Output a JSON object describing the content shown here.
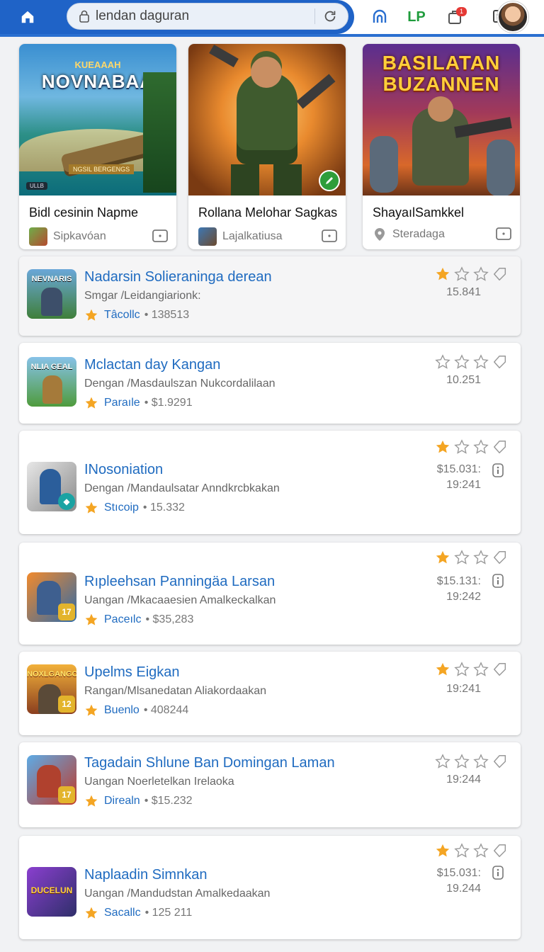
{
  "browser": {
    "url_text": "lendan daguran",
    "cart_badge": "1",
    "lp_label": "LP"
  },
  "featured": [
    {
      "title": "Bidl cesinin Napme",
      "meta": "Sipkavóan",
      "art_title": "NOVNABAA",
      "art_sub": "KUEAAAH",
      "art_tag": "NGSIL BERGENGS",
      "art_tag2": "ULLB"
    },
    {
      "title": "Rollana Melohar Sagkas",
      "meta": "Lajalkatiusa"
    },
    {
      "title": "ShayaılSamkkel",
      "meta": "Steradaga",
      "art_title_1": "BASILATAN",
      "art_title_2": "BUZANNEN"
    }
  ],
  "items": [
    {
      "name": "Nadarsin Solieraninga derean",
      "sub": "Smgar /Leidangiarionk:",
      "publisher": "Tâcollc",
      "count": "• 138513",
      "stars": 1,
      "numbers": [
        "15.841"
      ],
      "has_info": false,
      "icon_label": "NEVNARIS",
      "overlay": ""
    },
    {
      "name": "Mclactan day Kangan",
      "sub": "Dengan /Masdaulszan Nukcordalilaan",
      "publisher": "Paraıle",
      "count": "• $1.9291",
      "stars": 0,
      "numbers": [
        "10.251"
      ],
      "has_info": false,
      "icon_label": "NLIA GEAL",
      "overlay": ""
    },
    {
      "name": "INosoniation",
      "sub": "Dengan /Mandaulsatar Anndkrcbkakan",
      "publisher": "Stıcoip",
      "count": "• 15.332",
      "stars": 1,
      "numbers": [
        "$15.031:",
        "19:241"
      ],
      "has_info": true,
      "icon_label": "",
      "overlay": ""
    },
    {
      "name": "Rıpleehsan Panningäa Larsan",
      "sub": "Uangan /Mkacaaesien Amalkeckalkan",
      "publisher": "Paceılc",
      "count": "• $35,283",
      "stars": 1,
      "numbers": [
        "$15.131:",
        "19:242"
      ],
      "has_info": true,
      "icon_label": "",
      "overlay": "17"
    },
    {
      "name": "Upelms Eigkan",
      "sub": "Rangan/Mlsanedatan Aliakordaakan",
      "publisher": "Buenlo",
      "count": "• 408244",
      "stars": 1,
      "numbers": [
        "19:241"
      ],
      "has_info": false,
      "icon_label": "NOXLGANGO",
      "overlay": "12"
    },
    {
      "name": "Tagadain Shlune Ban Domingan Laman",
      "sub": "Uangan Noerletelkan Irelaoka",
      "publisher": "Direaln",
      "count": "• $15.232",
      "stars": 0,
      "numbers": [
        "19:244"
      ],
      "has_info": false,
      "icon_label": "",
      "overlay": "17"
    },
    {
      "name": "Naplaadin Simnkan",
      "sub": "Uangan /Mandudstan Amalkedaakan",
      "publisher": "Sacallc",
      "count": "• 125 211",
      "stars": 1,
      "numbers": [
        "$15.031:",
        "19.244"
      ],
      "has_info": true,
      "icon_label": "DUCELUN",
      "overlay": ""
    }
  ],
  "colors": {
    "accent": "#1f63c7",
    "star": "#f4a523",
    "link": "#1f6bc0"
  },
  "icons": [
    "home-icon",
    "lock-icon",
    "reload-icon",
    "arch-icon",
    "cart-icon",
    "tray-icon",
    "star-icon",
    "tag-icon",
    "message-icon",
    "info-icon"
  ]
}
